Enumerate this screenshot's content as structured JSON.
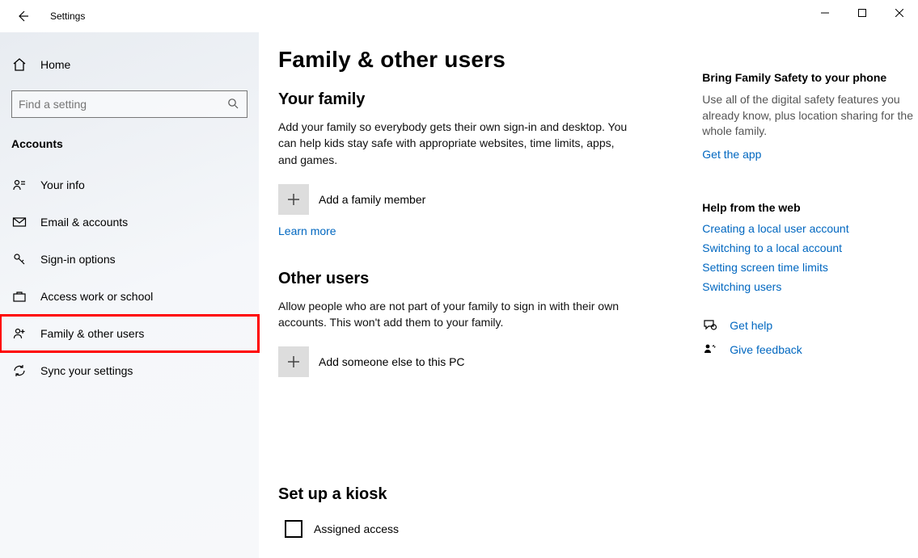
{
  "window": {
    "title": "Settings"
  },
  "sidebar": {
    "home": "Home",
    "search_placeholder": "Find a setting",
    "section": "Accounts",
    "items": [
      {
        "label": "Your info"
      },
      {
        "label": "Email & accounts"
      },
      {
        "label": "Sign-in options"
      },
      {
        "label": "Access work or school"
      },
      {
        "label": "Family & other users"
      },
      {
        "label": "Sync your settings"
      }
    ]
  },
  "page": {
    "title": "Family & other users",
    "family": {
      "heading": "Your family",
      "desc": "Add your family so everybody gets their own sign-in and desktop. You can help kids stay safe with appropriate websites, time limits, apps, and games.",
      "add_label": "Add a family member",
      "learn_more": "Learn more"
    },
    "other": {
      "heading": "Other users",
      "desc": "Allow people who are not part of your family to sign in with their own accounts. This won't add them to your family.",
      "add_label": "Add someone else to this PC"
    },
    "kiosk": {
      "heading": "Set up a kiosk",
      "assigned": "Assigned access"
    }
  },
  "right": {
    "safety": {
      "heading": "Bring Family Safety to your phone",
      "desc": "Use all of the digital safety features you already know, plus location sharing for the whole family.",
      "link": "Get the app"
    },
    "help": {
      "heading": "Help from the web",
      "links": [
        "Creating a local user account",
        "Switching to a local account",
        "Setting screen time limits",
        "Switching users"
      ]
    },
    "support": {
      "get_help": "Get help",
      "feedback": "Give feedback"
    }
  }
}
